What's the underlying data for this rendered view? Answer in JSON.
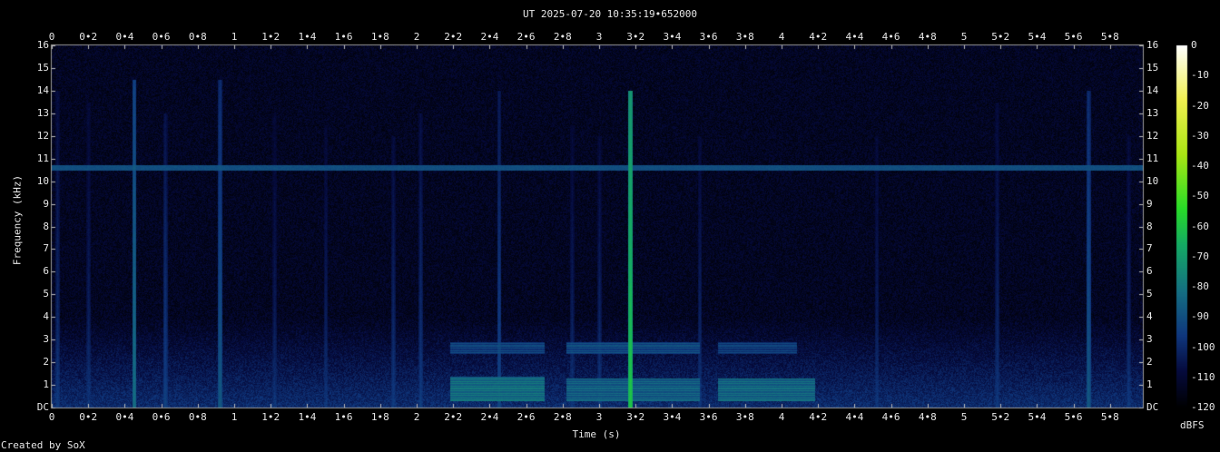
{
  "title": "UT 2025-07-20 10:35:19•652000",
  "credit": "Created by SoX",
  "chart_data": {
    "type": "heatmap",
    "title": "UT 2025-07-20 10:35:19•652000",
    "xlabel": "Time (s)",
    "ylabel": "Frequency (kHz)",
    "xlim": [
      0,
      5.98
    ],
    "ylim": [
      0,
      16
    ],
    "x_ticks": [
      "0",
      "0•2",
      "0•4",
      "0•6",
      "0•8",
      "1",
      "1•2",
      "1•4",
      "1•6",
      "1•8",
      "2",
      "2•2",
      "2•4",
      "2•6",
      "2•8",
      "3",
      "3•2",
      "3•4",
      "3•6",
      "3•8",
      "4",
      "4•2",
      "4•4",
      "4•6",
      "4•8",
      "5",
      "5•2",
      "5•4",
      "5•6",
      "5•8"
    ],
    "y_ticks": [
      "DC",
      "1",
      "2",
      "3",
      "4",
      "5",
      "6",
      "7",
      "8",
      "9",
      "10",
      "11",
      "12",
      "13",
      "14",
      "15",
      "16"
    ],
    "colorbar": {
      "label": "dBFS",
      "ticks": [
        "0",
        "-10",
        "-20",
        "-30",
        "-40",
        "-50",
        "-60",
        "-70",
        "-80",
        "-90",
        "-100",
        "-110",
        "-120"
      ],
      "range": [
        -120,
        0
      ]
    },
    "noise_floor_dbfs": -118,
    "horizontal_tone": {
      "freq_khz": 10.6,
      "level_dbfs": -92
    },
    "transients": [
      {
        "t": 0.03,
        "fmax": 14.0,
        "level": -98
      },
      {
        "t": 0.2,
        "fmax": 13.5,
        "level": -100
      },
      {
        "t": 0.45,
        "fmax": 14.5,
        "level": -82
      },
      {
        "t": 0.62,
        "fmax": 13.0,
        "level": -95
      },
      {
        "t": 0.92,
        "fmax": 14.5,
        "level": -88
      },
      {
        "t": 1.22,
        "fmax": 13.0,
        "level": -101
      },
      {
        "t": 1.5,
        "fmax": 12.5,
        "level": -100
      },
      {
        "t": 1.87,
        "fmax": 12.0,
        "level": -98
      },
      {
        "t": 2.02,
        "fmax": 13.0,
        "level": -97
      },
      {
        "t": 2.45,
        "fmax": 14.0,
        "level": -93
      },
      {
        "t": 2.85,
        "fmax": 12.5,
        "level": -100
      },
      {
        "t": 3.0,
        "fmax": 12.0,
        "level": -99
      },
      {
        "t": 3.17,
        "fmax": 14.0,
        "level": -60
      },
      {
        "t": 3.55,
        "fmax": 12.0,
        "level": -99
      },
      {
        "t": 4.52,
        "fmax": 12.0,
        "level": -100
      },
      {
        "t": 5.18,
        "fmax": 13.5,
        "level": -99
      },
      {
        "t": 5.68,
        "fmax": 14.0,
        "level": -88
      },
      {
        "t": 5.9,
        "fmax": 12.0,
        "level": -99
      }
    ],
    "harmonic_bands": [
      {
        "t0": 2.18,
        "t1": 2.7,
        "f0": 0.3,
        "f1": 1.4,
        "level": -80
      },
      {
        "t0": 2.18,
        "t1": 2.7,
        "f0": 2.4,
        "f1": 2.9,
        "level": -92
      },
      {
        "t0": 2.82,
        "t1": 3.55,
        "f0": 0.3,
        "f1": 1.3,
        "level": -84
      },
      {
        "t0": 2.82,
        "t1": 3.55,
        "f0": 2.4,
        "f1": 2.9,
        "level": -90
      },
      {
        "t0": 3.65,
        "t1": 4.18,
        "f0": 0.3,
        "f1": 1.3,
        "level": -82
      },
      {
        "t0": 3.65,
        "t1": 4.08,
        "f0": 2.4,
        "f1": 2.9,
        "level": -93
      }
    ]
  }
}
